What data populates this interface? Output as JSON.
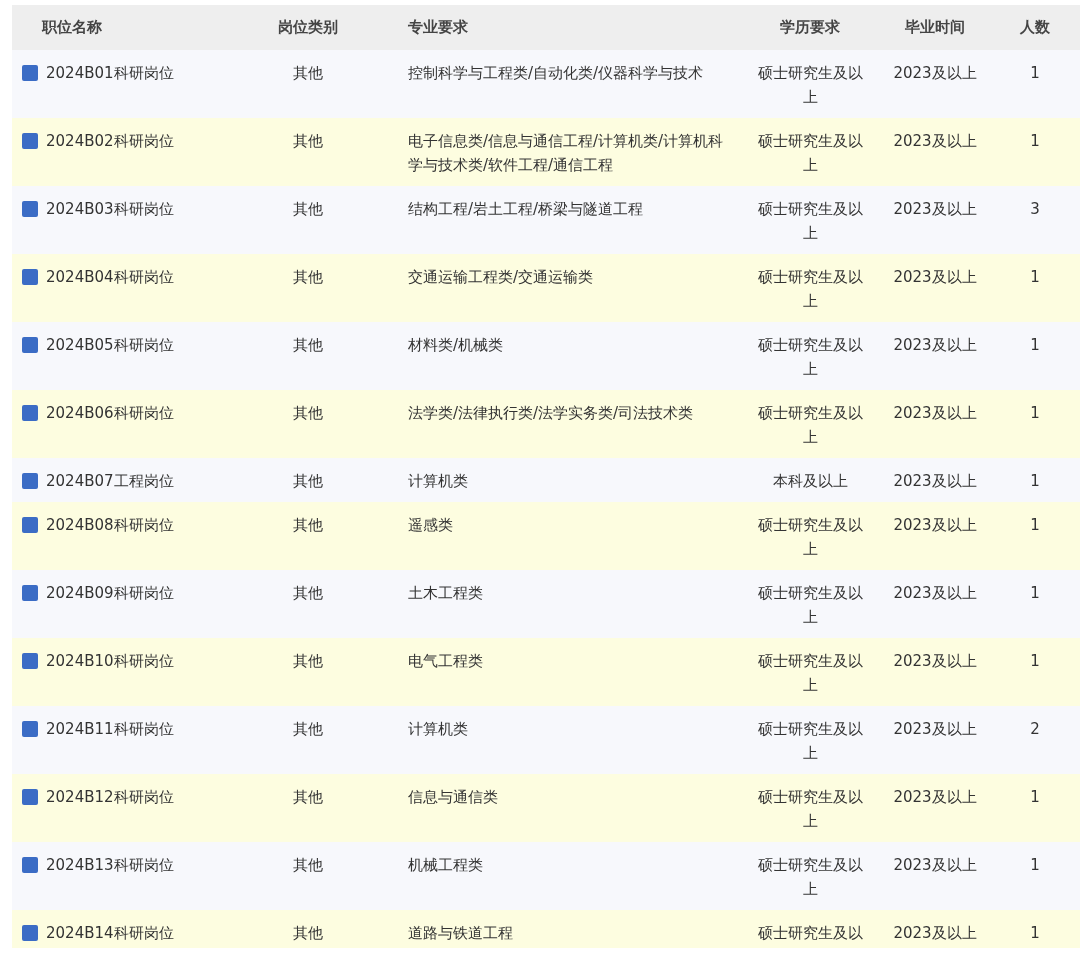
{
  "table": {
    "columns": [
      "职位名称",
      "岗位类别",
      "专业要求",
      "学历要求",
      "毕业时间",
      "人数"
    ],
    "rows": [
      {
        "name": "2024B01科研岗位",
        "category": "其他",
        "major": "控制科学与工程类/自动化类/仪器科学与技术",
        "education": "硕士研究生及以上",
        "graduation": "2023及以上",
        "count": "1"
      },
      {
        "name": "2024B02科研岗位",
        "category": "其他",
        "major": "电子信息类/信息与通信工程/计算机类/计算机科学与技术类/软件工程/通信工程",
        "education": "硕士研究生及以上",
        "graduation": "2023及以上",
        "count": "1"
      },
      {
        "name": "2024B03科研岗位",
        "category": "其他",
        "major": "结构工程/岩土工程/桥梁与隧道工程",
        "education": "硕士研究生及以上",
        "graduation": "2023及以上",
        "count": "3"
      },
      {
        "name": "2024B04科研岗位",
        "category": "其他",
        "major": "交通运输工程类/交通运输类",
        "education": "硕士研究生及以上",
        "graduation": "2023及以上",
        "count": "1"
      },
      {
        "name": "2024B05科研岗位",
        "category": "其他",
        "major": "材料类/机械类",
        "education": "硕士研究生及以上",
        "graduation": "2023及以上",
        "count": "1"
      },
      {
        "name": "2024B06科研岗位",
        "category": "其他",
        "major": "法学类/法律执行类/法学实务类/司法技术类",
        "education": "硕士研究生及以上",
        "graduation": "2023及以上",
        "count": "1"
      },
      {
        "name": "2024B07工程岗位",
        "category": "其他",
        "major": "计算机类",
        "education": "本科及以上",
        "graduation": "2023及以上",
        "count": "1"
      },
      {
        "name": "2024B08科研岗位",
        "category": "其他",
        "major": "遥感类",
        "education": "硕士研究生及以上",
        "graduation": "2023及以上",
        "count": "1"
      },
      {
        "name": "2024B09科研岗位",
        "category": "其他",
        "major": "土木工程类",
        "education": "硕士研究生及以上",
        "graduation": "2023及以上",
        "count": "1"
      },
      {
        "name": "2024B10科研岗位",
        "category": "其他",
        "major": "电气工程类",
        "education": "硕士研究生及以上",
        "graduation": "2023及以上",
        "count": "1"
      },
      {
        "name": "2024B11科研岗位",
        "category": "其他",
        "major": "计算机类",
        "education": "硕士研究生及以上",
        "graduation": "2023及以上",
        "count": "2"
      },
      {
        "name": "2024B12科研岗位",
        "category": "其他",
        "major": "信息与通信类",
        "education": "硕士研究生及以上",
        "graduation": "2023及以上",
        "count": "1"
      },
      {
        "name": "2024B13科研岗位",
        "category": "其他",
        "major": "机械工程类",
        "education": "硕士研究生及以上",
        "graduation": "2023及以上",
        "count": "1"
      },
      {
        "name": "2024B14科研岗位",
        "category": "其他",
        "major": "道路与铁道工程",
        "education": "硕士研究生及以",
        "graduation": "2023及以上",
        "count": "1"
      }
    ]
  }
}
